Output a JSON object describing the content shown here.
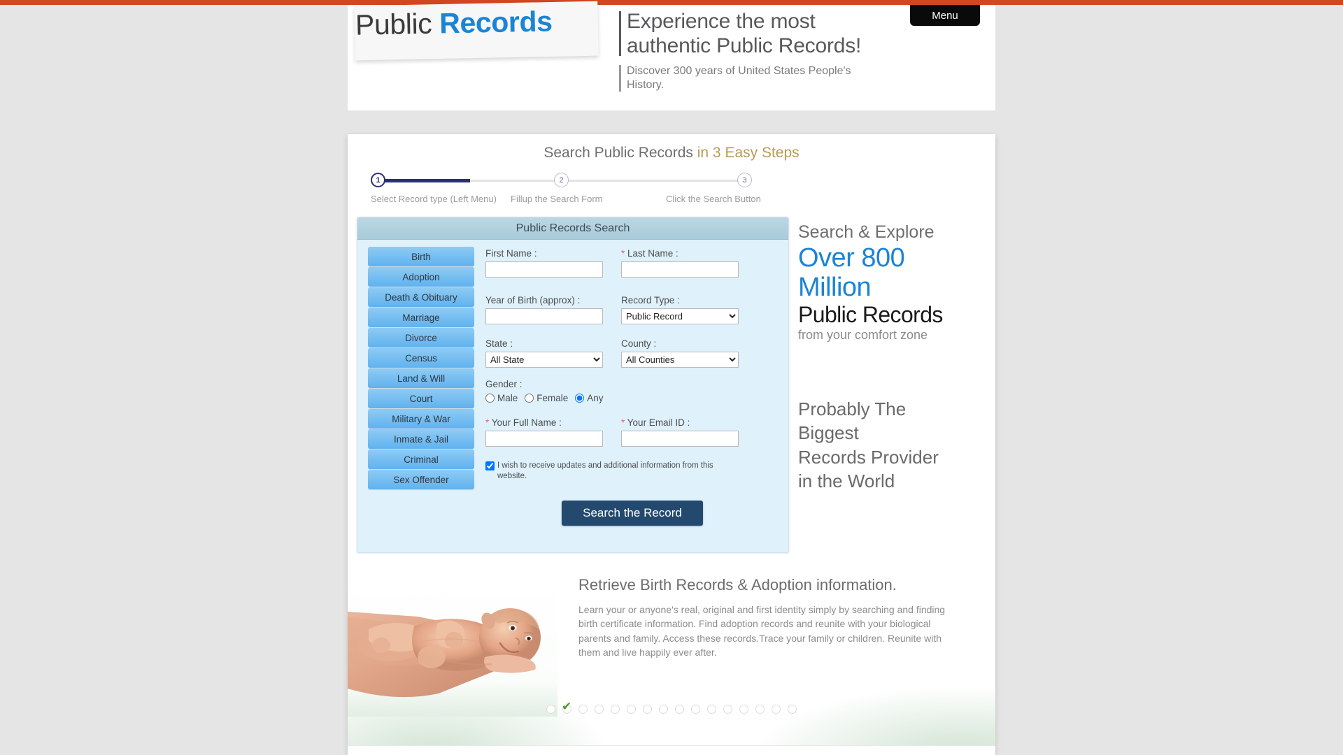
{
  "brand": {
    "logo_prefix": "Public ",
    "logo_suffix": "Records",
    "accent_color": "#1a84d6",
    "top_bar_color": "#d24620"
  },
  "header": {
    "tagline_line1": "Experience the most",
    "tagline_line2": "authentic Public Records!",
    "subtagline": "Discover 300 years of United States People's History.",
    "menu_label": "Menu"
  },
  "steps": {
    "title_main": "Search Public Records ",
    "title_accent": "in 3 Easy Steps",
    "nodes": [
      {
        "number": "1",
        "label": "Select Record type (Left Menu)",
        "active": true
      },
      {
        "number": "2",
        "label": "Fillup the Search Form",
        "active": false
      },
      {
        "number": "3",
        "label": "Click the Search Button",
        "active": false
      }
    ]
  },
  "search_panel": {
    "heading": "Public Records Search",
    "record_menu": [
      {
        "label": "Birth"
      },
      {
        "label": "Adoption"
      },
      {
        "label": "Death & Obituary"
      },
      {
        "label": "Marriage"
      },
      {
        "label": "Divorce"
      },
      {
        "label": "Census"
      },
      {
        "label": "Land & Will"
      },
      {
        "label": "Court"
      },
      {
        "label": "Military & War"
      },
      {
        "label": "Inmate & Jail"
      },
      {
        "label": "Criminal"
      },
      {
        "label": "Sex Offender"
      }
    ],
    "fields": {
      "first_name_label": "First Name :",
      "first_name_value": "",
      "last_name_label": "Last Name :",
      "last_name_required": "*",
      "last_name_value": "",
      "year_label": "Year of Birth (approx) :",
      "year_value": "",
      "record_type_label": "Record Type :",
      "record_type_value": "Public Record",
      "state_label": "State :",
      "state_value": "All State",
      "county_label": "County :",
      "county_value": "All Counties",
      "gender_label": "Gender :",
      "gender_options": [
        "Male",
        "Female",
        "Any"
      ],
      "gender_selected": "Any",
      "full_name_label": "Your Full Name :",
      "full_name_required": "*",
      "full_name_value": "",
      "email_label": "Your Email ID :",
      "email_required": "*",
      "email_value": "",
      "consent_text": "I wish to receive updates and additional information from this website.",
      "consent_checked": true,
      "submit_label": "Search the Record"
    }
  },
  "promo": {
    "line1": "Search & Explore",
    "line2": "Over 800",
    "line3": "Million",
    "line4": "Public Records",
    "line5": "from your comfort zone",
    "block2_line1": "Probably The",
    "block2_line2": "Biggest",
    "block2_line3": "Records Provider",
    "block2_line4": "in the World"
  },
  "feature": {
    "title": "Retrieve Birth Records & Adoption information.",
    "body": "Learn your or anyone's real, original and first identity simply by searching and finding birth certificate information. Find adoption records and reunite with your biological parents and family. Access these records.Trace your family or children. Reunite with them and live happily ever after.",
    "image_alt": "newborn-baby-in-hands-photo",
    "carousel_total": 16,
    "carousel_checked_index": 1
  }
}
